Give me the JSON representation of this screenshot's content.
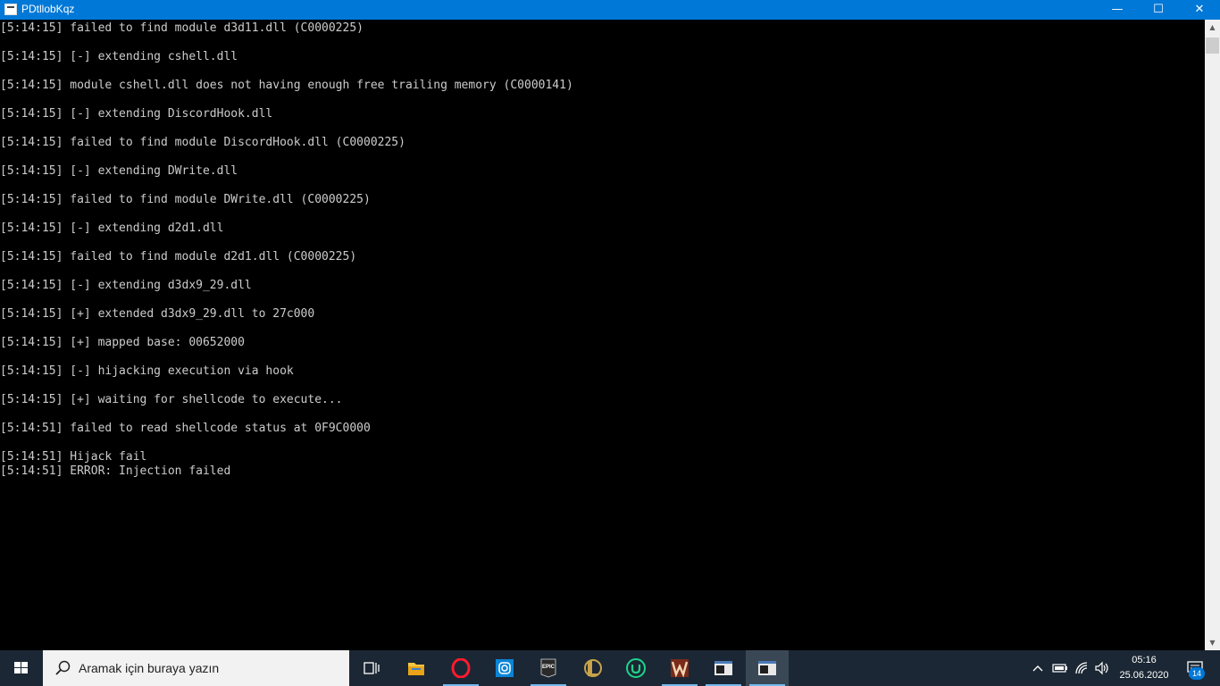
{
  "window": {
    "title": "PDtllobKqz",
    "minimize_label": "—",
    "maximize_label": "☐",
    "close_label": "✕"
  },
  "console": {
    "lines": [
      "[5:14:15] failed to find module d3d11.dll (C0000225)",
      "[5:14:15] [-] extending cshell.dll",
      "[5:14:15] module cshell.dll does not having enough free trailing memory (C0000141)",
      "[5:14:15] [-] extending DiscordHook.dll",
      "[5:14:15] failed to find module DiscordHook.dll (C0000225)",
      "[5:14:15] [-] extending DWrite.dll",
      "[5:14:15] failed to find module DWrite.dll (C0000225)",
      "[5:14:15] [-] extending d2d1.dll",
      "[5:14:15] failed to find module d2d1.dll (C0000225)",
      "[5:14:15] [-] extending d3dx9_29.dll",
      "[5:14:15] [+] extended d3dx9_29.dll to 27c000",
      "[5:14:15] [+] mapped base: 00652000",
      "[5:14:15] [-] hijacking execution via hook",
      "[5:14:15] [+] waiting for shellcode to execute...",
      "[5:14:51] failed to read shellcode status at 0F9C0000",
      "[5:14:51] Hijack fail",
      "[5:14:51] ERROR: Injection failed"
    ],
    "text_color": "#cccccc",
    "background": "#000000"
  },
  "taskbar": {
    "search_placeholder": "Aramak için buraya yazın",
    "apps": [
      {
        "name": "task-view-icon"
      },
      {
        "name": "file-explorer-icon"
      },
      {
        "name": "opera-icon"
      },
      {
        "name": "instagram-icon"
      },
      {
        "name": "epic-games-icon",
        "label": "EPIC"
      },
      {
        "name": "league-of-legends-icon"
      },
      {
        "name": "utorrent-icon"
      },
      {
        "name": "game-launcher-icon"
      },
      {
        "name": "console-window-icon"
      },
      {
        "name": "console-window-active-icon"
      }
    ],
    "clock_time": "05:16",
    "clock_date": "25.06.2020",
    "notification_count": "14",
    "accent": "#0078d7"
  }
}
